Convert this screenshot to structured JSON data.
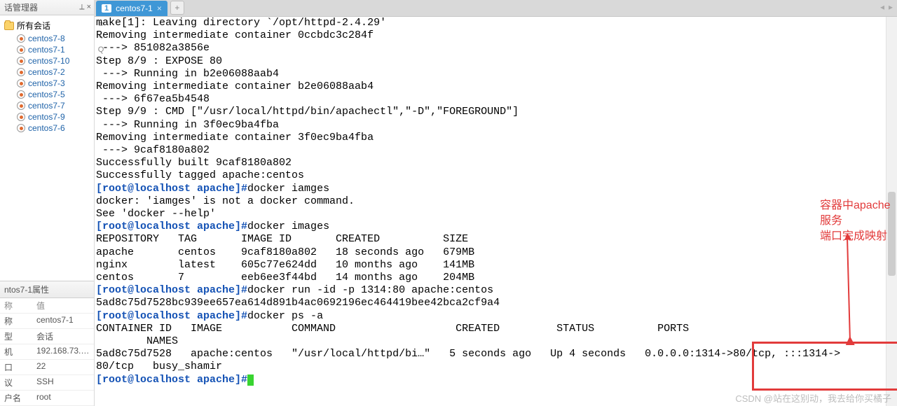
{
  "sidebar": {
    "panel_title": "话管理器",
    "root_label": "所有会话",
    "items": [
      {
        "label": "centos7-8"
      },
      {
        "label": "centos7-1"
      },
      {
        "label": "centos7-10"
      },
      {
        "label": "centos7-2"
      },
      {
        "label": "centos7-3"
      },
      {
        "label": "centos7-5"
      },
      {
        "label": "centos7-7"
      },
      {
        "label": "centos7-9"
      },
      {
        "label": "centos7-6"
      }
    ]
  },
  "properties": {
    "title": "ntos7-1属性",
    "rows": [
      {
        "k": "称",
        "v": "值"
      },
      {
        "k": "称",
        "v": "centos7-1"
      },
      {
        "k": "型",
        "v": "会话"
      },
      {
        "k": "机",
        "v": "192.168.73.1…"
      },
      {
        "k": "口",
        "v": "22"
      },
      {
        "k": "议",
        "v": "SSH"
      },
      {
        "k": "户名",
        "v": "root"
      }
    ]
  },
  "tabs": {
    "active": {
      "num": "1",
      "label": "centos7-1"
    },
    "plus": "+"
  },
  "terminal": {
    "lines": [
      {
        "t": "make[1]: Leaving directory `/opt/httpd-2.4.29'"
      },
      {
        "t": "Removing intermediate container 0ccbdc3c284f"
      },
      {
        "t": " ---> 851082a3856e"
      },
      {
        "t": "Step 8/9 : EXPOSE 80"
      },
      {
        "t": " ---> Running in b2e06088aab4"
      },
      {
        "t": "Removing intermediate container b2e06088aab4"
      },
      {
        "t": " ---> 6f67ea5b4548"
      },
      {
        "t": "Step 9/9 : CMD [\"/usr/local/httpd/bin/apachectl\",\"-D\",\"FOREGROUND\"]"
      },
      {
        "t": " ---> Running in 3f0ec9ba4fba"
      },
      {
        "t": "Removing intermediate container 3f0ec9ba4fba"
      },
      {
        "t": " ---> 9caf8180a802"
      },
      {
        "t": "Successfully built 9caf8180a802"
      },
      {
        "t": "Successfully tagged apache:centos"
      },
      {
        "p": "[root@localhost apache]#",
        "c": "docker iamges"
      },
      {
        "t": "docker: 'iamges' is not a docker command."
      },
      {
        "t": "See 'docker --help'"
      },
      {
        "p": "[root@localhost apache]#",
        "c": "docker images"
      },
      {
        "t": "REPOSITORY   TAG       IMAGE ID       CREATED          SIZE"
      },
      {
        "t": "apache       centos    9caf8180a802   18 seconds ago   679MB"
      },
      {
        "t": "nginx        latest    605c77e624dd   10 months ago    141MB"
      },
      {
        "t": "centos       7         eeb6ee3f44bd   14 months ago    204MB"
      },
      {
        "p": "[root@localhost apache]#",
        "c": "docker run -id -p 1314:80 apache:centos"
      },
      {
        "t": "5ad8c75d7528bc939ee657ea614d891b4ac0692196ec464419bee42bca2cf9a4"
      },
      {
        "p": "[root@localhost apache]#",
        "c": "docker ps -a"
      },
      {
        "t": "CONTAINER ID   IMAGE           COMMAND                   CREATED         STATUS          PORTS"
      },
      {
        "t": "        NAMES"
      },
      {
        "t": "5ad8c75d7528   apache:centos   \"/usr/local/httpd/bi…\"   5 seconds ago   Up 4 seconds   0.0.0.0:1314->80/tcp, :::1314->"
      },
      {
        "t": "80/tcp   busy_shamir"
      },
      {
        "p": "[root@localhost apache]#",
        "cursor": true
      }
    ]
  },
  "annotation": {
    "line1": "容器中apache服务",
    "line2": "端口完成映射"
  },
  "watermark": "CSDN @站在这别动，我去给你买橘子"
}
